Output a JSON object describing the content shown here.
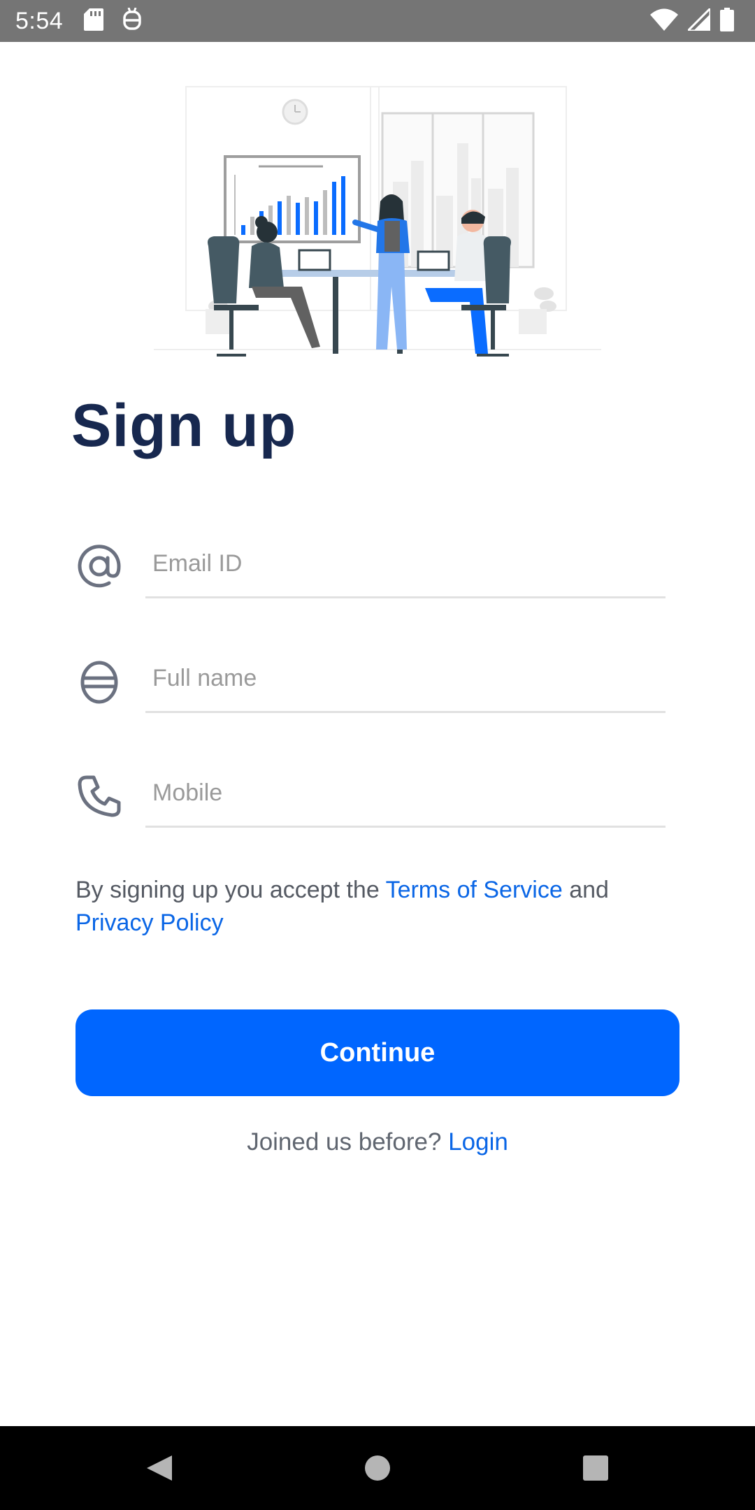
{
  "status_bar": {
    "time": "5:54",
    "icons": [
      "sd-card-icon",
      "debug-icon",
      "wifi-icon",
      "signal-icon",
      "battery-icon"
    ]
  },
  "page": {
    "title": "Sign up"
  },
  "form": {
    "email": {
      "placeholder": "Email ID",
      "value": "",
      "icon": "at-icon"
    },
    "full_name": {
      "placeholder": "Full name",
      "value": "",
      "icon": "user-icon"
    },
    "mobile": {
      "placeholder": "Mobile",
      "value": "",
      "icon": "phone-icon"
    }
  },
  "terms": {
    "prefix": "By signing up you accept the ",
    "terms_link": "Terms of Service",
    "middle": " and",
    "privacy_link": "Privacy Policy"
  },
  "actions": {
    "continue_label": "Continue",
    "login_prompt": "Joined us before? ",
    "login_link": "Login"
  },
  "colors": {
    "primary": "#0066ff",
    "link": "#0a66e6",
    "title": "#17284f",
    "status_bar": "#757575"
  },
  "nav_bar": {
    "icons": [
      "back-icon",
      "home-icon",
      "recents-icon"
    ]
  }
}
